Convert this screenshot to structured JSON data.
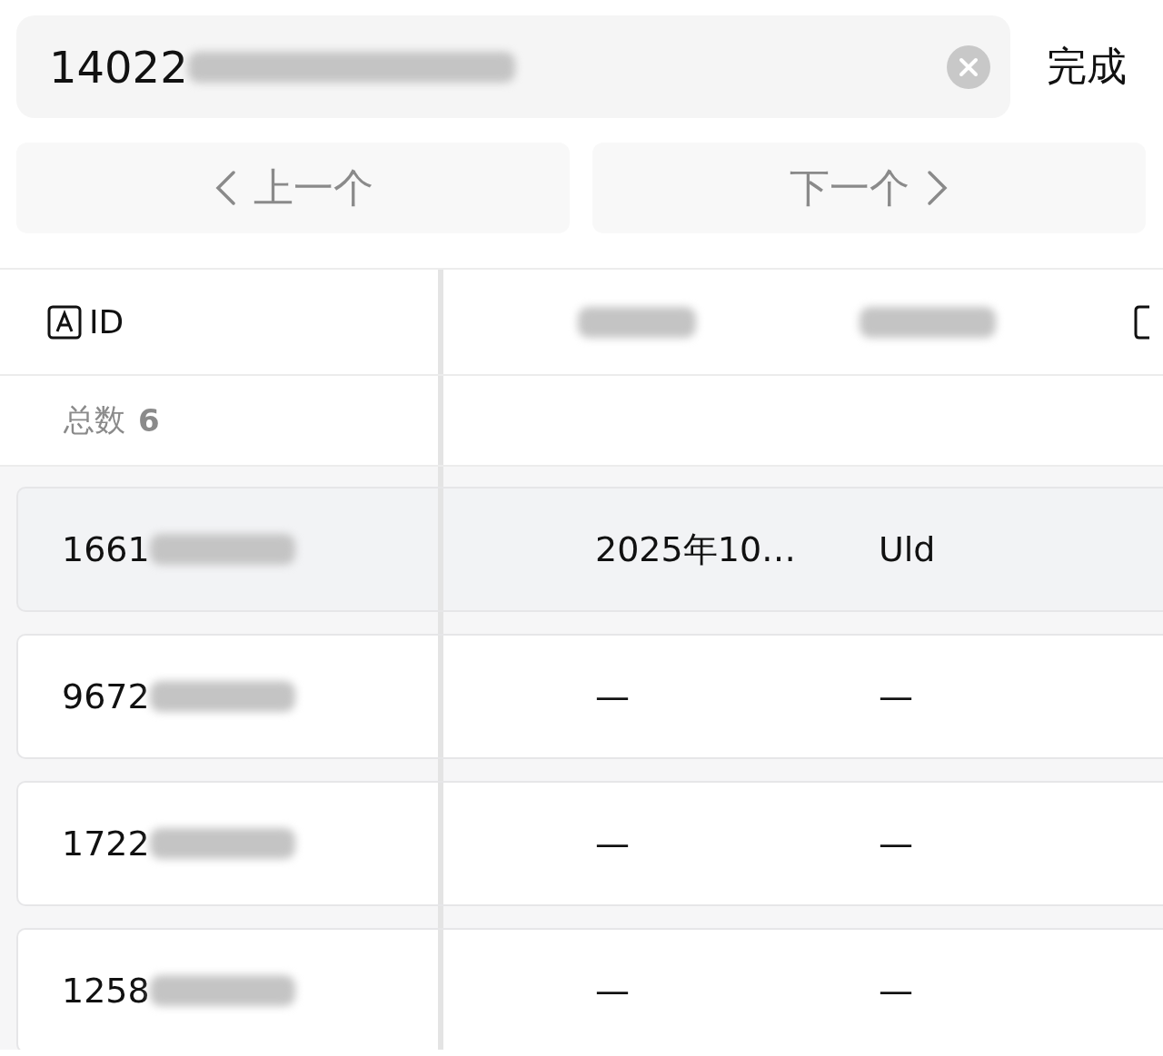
{
  "search": {
    "value": "14022",
    "done": "完成"
  },
  "nav": [
    {
      "kind": "prev",
      "label": "上一个"
    },
    {
      "kind": "next",
      "label": "下一个"
    }
  ],
  "table": {
    "columns": [
      {
        "label": "ID"
      }
    ],
    "summary": {
      "label": "总数",
      "count": "6"
    },
    "rows": [
      {
        "id": "1661",
        "selected": true,
        "column_2": "2025年10…",
        "column_3": "Uld"
      },
      {
        "id": "9672",
        "selected": false,
        "column_2": "—",
        "column_3": "—"
      },
      {
        "id": "1722",
        "selected": false,
        "column_2": "—",
        "column_3": "—"
      },
      {
        "id": "1258",
        "selected": false,
        "column_2": "—",
        "column_3": "—"
      }
    ]
  }
}
